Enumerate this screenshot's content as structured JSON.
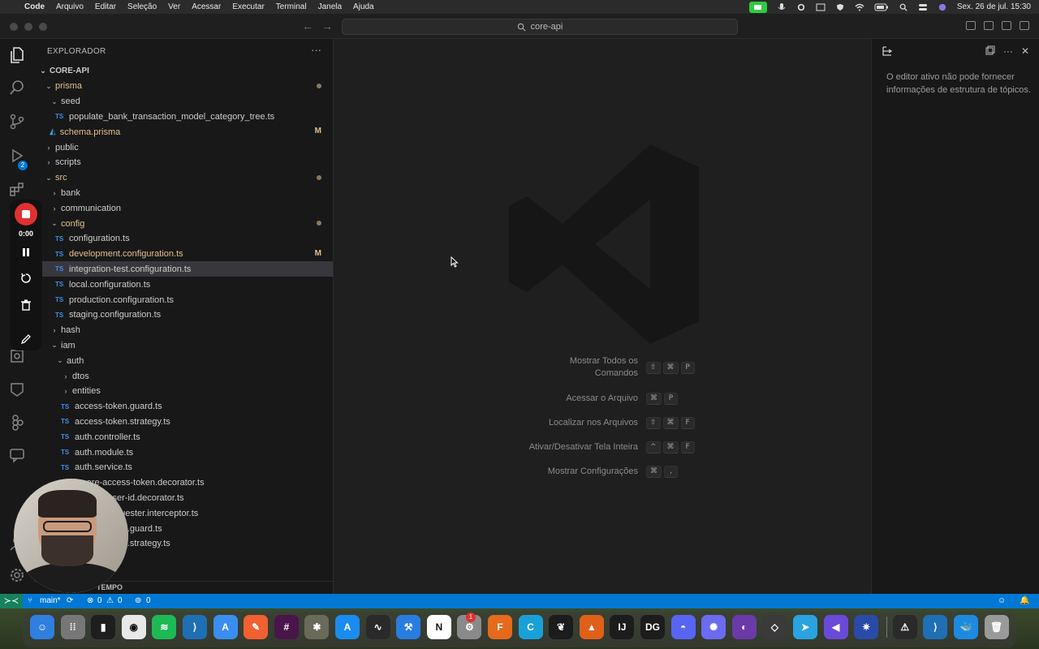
{
  "menubar": {
    "app": "Code",
    "items": [
      "Arquivo",
      "Editar",
      "Seleção",
      "Ver",
      "Acessar",
      "Executar",
      "Terminal",
      "Janela",
      "Ajuda"
    ],
    "datetime": "Sex. 26 de jul.  15:30",
    "status_icons": [
      "facetime-icon",
      "mic-icon",
      "gear-icon",
      "screen-icon",
      "shield-icon",
      "wifi-icon",
      "battery-icon",
      "search-icon",
      "control-center-icon",
      "siri-icon"
    ]
  },
  "titlebar": {
    "search": "core-api"
  },
  "activitybar": {
    "scm_badge": "2"
  },
  "recorder": {
    "time": "0:00"
  },
  "explorer": {
    "header": "EXPLORADOR",
    "more": "···",
    "footer": "TEMPO",
    "rows": [
      {
        "label": "CORE-API",
        "indent": 0,
        "type": "root",
        "chev": "⌄"
      },
      {
        "label": "prisma",
        "indent": 1,
        "type": "folder",
        "chev": "⌄",
        "color": "yellow",
        "mark": "dot"
      },
      {
        "label": "seed",
        "indent": 2,
        "type": "folder",
        "chev": "⌄"
      },
      {
        "label": "populate_bank_transaction_model_category_tree.ts",
        "indent": 3,
        "type": "ts"
      },
      {
        "label": "schema.prisma",
        "indent": 2,
        "type": "prisma",
        "color": "yellow",
        "mark": "M"
      },
      {
        "label": "public",
        "indent": 1,
        "type": "folder",
        "chev": "›"
      },
      {
        "label": "scripts",
        "indent": 1,
        "type": "folder",
        "chev": "›"
      },
      {
        "label": "src",
        "indent": 1,
        "type": "folder",
        "chev": "⌄",
        "color": "yellow",
        "mark": "dot"
      },
      {
        "label": "bank",
        "indent": 2,
        "type": "folder",
        "chev": "›"
      },
      {
        "label": "communication",
        "indent": 2,
        "type": "folder",
        "chev": "›"
      },
      {
        "label": "config",
        "indent": 2,
        "type": "folder",
        "chev": "⌄",
        "color": "yellow",
        "mark": "dot"
      },
      {
        "label": "configuration.ts",
        "indent": 3,
        "type": "ts"
      },
      {
        "label": "development.configuration.ts",
        "indent": 3,
        "type": "ts",
        "color": "yellow",
        "mark": "M"
      },
      {
        "label": "integration-test.configuration.ts",
        "indent": 3,
        "type": "ts",
        "selected": true
      },
      {
        "label": "local.configuration.ts",
        "indent": 3,
        "type": "ts"
      },
      {
        "label": "production.configuration.ts",
        "indent": 3,
        "type": "ts"
      },
      {
        "label": "staging.configuration.ts",
        "indent": 3,
        "type": "ts"
      },
      {
        "label": "hash",
        "indent": 2,
        "type": "folder",
        "chev": "›"
      },
      {
        "label": "iam",
        "indent": 2,
        "type": "folder",
        "chev": "⌄"
      },
      {
        "label": "auth",
        "indent": 3,
        "type": "folder",
        "chev": "⌄"
      },
      {
        "label": "dtos",
        "indent": 4,
        "type": "folder",
        "chev": "›"
      },
      {
        "label": "entities",
        "indent": 4,
        "type": "folder",
        "chev": "›"
      },
      {
        "label": "access-token.guard.ts",
        "indent": 4,
        "type": "ts"
      },
      {
        "label": "access-token.strategy.ts",
        "indent": 4,
        "type": "ts"
      },
      {
        "label": "auth.controller.ts",
        "indent": 4,
        "type": "ts"
      },
      {
        "label": "auth.module.ts",
        "indent": 4,
        "type": "ts"
      },
      {
        "label": "auth.service.ts",
        "indent": 4,
        "type": "ts"
      },
      {
        "label": "ignore-access-token.decorator.ts",
        "indent": 4,
        "type": "ts"
      },
      {
        "label": "request-user-id.decorator.ts",
        "indent": 4,
        "type": "ts"
      },
      {
        "label": "request-requester.interceptor.ts",
        "indent": 4,
        "type": "ts"
      },
      {
        "label": "refresh-token.guard.ts",
        "indent": 4,
        "type": "ts"
      },
      {
        "label": "refresh-token.strategy.ts",
        "indent": 4,
        "type": "ts"
      }
    ]
  },
  "editor": {
    "shortcuts": [
      {
        "label": "Mostrar Todos os Comandos",
        "keys": [
          "⇧",
          "⌘",
          "P"
        ]
      },
      {
        "label": "Acessar o Arquivo",
        "keys": [
          "⌘",
          "P"
        ]
      },
      {
        "label": "Localizar nos Arquivos",
        "keys": [
          "⇧",
          "⌘",
          "F"
        ]
      },
      {
        "label": "Ativar/Desativar Tela Inteira",
        "keys": [
          "^",
          "⌘",
          "F"
        ]
      },
      {
        "label": "Mostrar Configurações",
        "keys": [
          "⌘",
          ","
        ]
      }
    ]
  },
  "outline": {
    "message": "O editor ativo não pode fornecer informações de estrutura de tópicos."
  },
  "statusbar": {
    "branch": "main*",
    "errors": "0",
    "warnings": "0",
    "ports": "0"
  },
  "dock": {
    "apps": [
      {
        "name": "finder",
        "color": "#2f7fe0",
        "glyph": "☺"
      },
      {
        "name": "launchpad",
        "color": "#777",
        "glyph": "⁞⁞"
      },
      {
        "name": "terminal-app",
        "color": "#1e1e1e",
        "glyph": "▮"
      },
      {
        "name": "chrome",
        "color": "#e8e8e8",
        "glyph": "◉"
      },
      {
        "name": "spotify",
        "color": "#1db954",
        "glyph": "≋"
      },
      {
        "name": "vscode-1",
        "color": "#1f6fb5",
        "glyph": "⟩"
      },
      {
        "name": "arc",
        "color": "#3a8ef0",
        "glyph": "A"
      },
      {
        "name": "pencil-app",
        "color": "#f06030",
        "glyph": "✎"
      },
      {
        "name": "slack",
        "color": "#4a154b",
        "glyph": "#"
      },
      {
        "name": "gimp",
        "color": "#6a6a5a",
        "glyph": "✱"
      },
      {
        "name": "app-store",
        "color": "#1a8cf0",
        "glyph": "A"
      },
      {
        "name": "activity-monitor",
        "color": "#2a2a2a",
        "glyph": "∿"
      },
      {
        "name": "xcode",
        "color": "#2a7de0",
        "glyph": "⚒"
      },
      {
        "name": "notion",
        "color": "#ffffff",
        "glyph": "N"
      },
      {
        "name": "system-settings",
        "color": "#8a8a8a",
        "glyph": "⚙"
      },
      {
        "name": "f360",
        "color": "#e56a1c",
        "glyph": "F"
      },
      {
        "name": "app-c",
        "color": "#1aa0d8",
        "glyph": "C"
      },
      {
        "name": "mongodb",
        "color": "#1c1c1c",
        "glyph": "❦"
      },
      {
        "name": "matlab",
        "color": "#e0601a",
        "glyph": "▲"
      },
      {
        "name": "intellij",
        "color": "#1c1c1c",
        "glyph": "IJ"
      },
      {
        "name": "datagrip",
        "color": "#1c1c1c",
        "glyph": "DG"
      },
      {
        "name": "discord",
        "color": "#5865f2",
        "glyph": "◓"
      },
      {
        "name": "app-flower",
        "color": "#6b6bf0",
        "glyph": "✺"
      },
      {
        "name": "app-circle",
        "color": "#6a3aa8",
        "glyph": "◐"
      },
      {
        "name": "unity",
        "color": "#3a3a3a",
        "glyph": "◇"
      },
      {
        "name": "telegram",
        "color": "#2aa3e0",
        "glyph": "➤"
      },
      {
        "name": "app-rewind",
        "color": "#6a4ad8",
        "glyph": "◀"
      },
      {
        "name": "app-hex",
        "color": "#2a4aa8",
        "glyph": "✷"
      },
      {
        "name": "console",
        "color": "#2a2a2a",
        "glyph": "⚠"
      },
      {
        "name": "vscode-2",
        "color": "#1f6fb5",
        "glyph": "⟩"
      },
      {
        "name": "docker",
        "color": "#1d8ae0",
        "glyph": "🐳"
      },
      {
        "name": "trash",
        "color": "#9a9a9a",
        "glyph": "🗑"
      }
    ],
    "badge": "1"
  }
}
